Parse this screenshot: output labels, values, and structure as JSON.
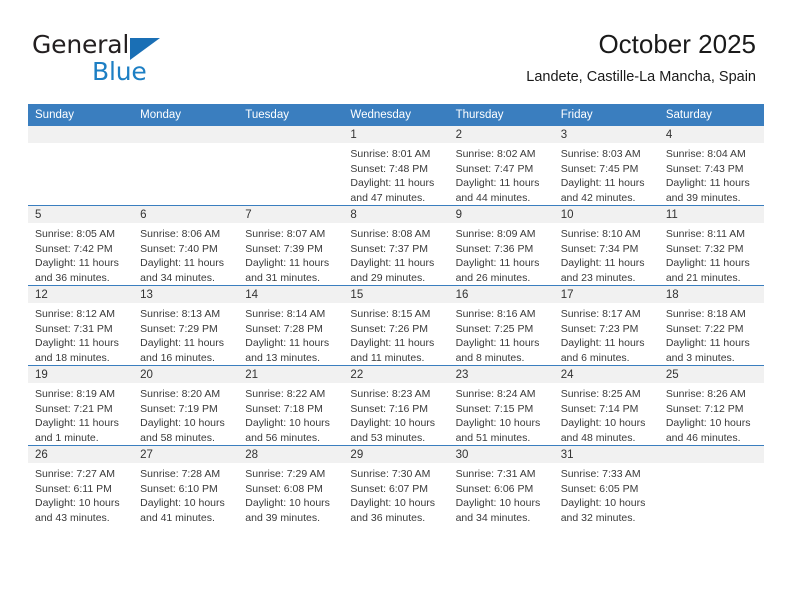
{
  "brand": {
    "name_part1": "General",
    "name_part2": "Blue",
    "triangle_color": "#1a6fb5",
    "blue_color": "#1d7fc4"
  },
  "header": {
    "title": "October 2025",
    "subtitle": "Landete, Castille-La Mancha, Spain"
  },
  "theme": {
    "header_bg": "#3a7ebf",
    "daynum_bg": "#f1f1f1",
    "text": "#3a3a3a"
  },
  "calendar": {
    "weekday_headers": [
      "Sunday",
      "Monday",
      "Tuesday",
      "Wednesday",
      "Thursday",
      "Friday",
      "Saturday"
    ],
    "weeks": [
      [
        {
          "day": "",
          "lines": []
        },
        {
          "day": "",
          "lines": []
        },
        {
          "day": "",
          "lines": []
        },
        {
          "day": "1",
          "lines": [
            "Sunrise: 8:01 AM",
            "Sunset: 7:48 PM",
            "Daylight: 11 hours",
            "and 47 minutes."
          ]
        },
        {
          "day": "2",
          "lines": [
            "Sunrise: 8:02 AM",
            "Sunset: 7:47 PM",
            "Daylight: 11 hours",
            "and 44 minutes."
          ]
        },
        {
          "day": "3",
          "lines": [
            "Sunrise: 8:03 AM",
            "Sunset: 7:45 PM",
            "Daylight: 11 hours",
            "and 42 minutes."
          ]
        },
        {
          "day": "4",
          "lines": [
            "Sunrise: 8:04 AM",
            "Sunset: 7:43 PM",
            "Daylight: 11 hours",
            "and 39 minutes."
          ]
        }
      ],
      [
        {
          "day": "5",
          "lines": [
            "Sunrise: 8:05 AM",
            "Sunset: 7:42 PM",
            "Daylight: 11 hours",
            "and 36 minutes."
          ]
        },
        {
          "day": "6",
          "lines": [
            "Sunrise: 8:06 AM",
            "Sunset: 7:40 PM",
            "Daylight: 11 hours",
            "and 34 minutes."
          ]
        },
        {
          "day": "7",
          "lines": [
            "Sunrise: 8:07 AM",
            "Sunset: 7:39 PM",
            "Daylight: 11 hours",
            "and 31 minutes."
          ]
        },
        {
          "day": "8",
          "lines": [
            "Sunrise: 8:08 AM",
            "Sunset: 7:37 PM",
            "Daylight: 11 hours",
            "and 29 minutes."
          ]
        },
        {
          "day": "9",
          "lines": [
            "Sunrise: 8:09 AM",
            "Sunset: 7:36 PM",
            "Daylight: 11 hours",
            "and 26 minutes."
          ]
        },
        {
          "day": "10",
          "lines": [
            "Sunrise: 8:10 AM",
            "Sunset: 7:34 PM",
            "Daylight: 11 hours",
            "and 23 minutes."
          ]
        },
        {
          "day": "11",
          "lines": [
            "Sunrise: 8:11 AM",
            "Sunset: 7:32 PM",
            "Daylight: 11 hours",
            "and 21 minutes."
          ]
        }
      ],
      [
        {
          "day": "12",
          "lines": [
            "Sunrise: 8:12 AM",
            "Sunset: 7:31 PM",
            "Daylight: 11 hours",
            "and 18 minutes."
          ]
        },
        {
          "day": "13",
          "lines": [
            "Sunrise: 8:13 AM",
            "Sunset: 7:29 PM",
            "Daylight: 11 hours",
            "and 16 minutes."
          ]
        },
        {
          "day": "14",
          "lines": [
            "Sunrise: 8:14 AM",
            "Sunset: 7:28 PM",
            "Daylight: 11 hours",
            "and 13 minutes."
          ]
        },
        {
          "day": "15",
          "lines": [
            "Sunrise: 8:15 AM",
            "Sunset: 7:26 PM",
            "Daylight: 11 hours",
            "and 11 minutes."
          ]
        },
        {
          "day": "16",
          "lines": [
            "Sunrise: 8:16 AM",
            "Sunset: 7:25 PM",
            "Daylight: 11 hours",
            "and 8 minutes."
          ]
        },
        {
          "day": "17",
          "lines": [
            "Sunrise: 8:17 AM",
            "Sunset: 7:23 PM",
            "Daylight: 11 hours",
            "and 6 minutes."
          ]
        },
        {
          "day": "18",
          "lines": [
            "Sunrise: 8:18 AM",
            "Sunset: 7:22 PM",
            "Daylight: 11 hours",
            "and 3 minutes."
          ]
        }
      ],
      [
        {
          "day": "19",
          "lines": [
            "Sunrise: 8:19 AM",
            "Sunset: 7:21 PM",
            "Daylight: 11 hours",
            "and 1 minute."
          ]
        },
        {
          "day": "20",
          "lines": [
            "Sunrise: 8:20 AM",
            "Sunset: 7:19 PM",
            "Daylight: 10 hours",
            "and 58 minutes."
          ]
        },
        {
          "day": "21",
          "lines": [
            "Sunrise: 8:22 AM",
            "Sunset: 7:18 PM",
            "Daylight: 10 hours",
            "and 56 minutes."
          ]
        },
        {
          "day": "22",
          "lines": [
            "Sunrise: 8:23 AM",
            "Sunset: 7:16 PM",
            "Daylight: 10 hours",
            "and 53 minutes."
          ]
        },
        {
          "day": "23",
          "lines": [
            "Sunrise: 8:24 AM",
            "Sunset: 7:15 PM",
            "Daylight: 10 hours",
            "and 51 minutes."
          ]
        },
        {
          "day": "24",
          "lines": [
            "Sunrise: 8:25 AM",
            "Sunset: 7:14 PM",
            "Daylight: 10 hours",
            "and 48 minutes."
          ]
        },
        {
          "day": "25",
          "lines": [
            "Sunrise: 8:26 AM",
            "Sunset: 7:12 PM",
            "Daylight: 10 hours",
            "and 46 minutes."
          ]
        }
      ],
      [
        {
          "day": "26",
          "lines": [
            "Sunrise: 7:27 AM",
            "Sunset: 6:11 PM",
            "Daylight: 10 hours",
            "and 43 minutes."
          ]
        },
        {
          "day": "27",
          "lines": [
            "Sunrise: 7:28 AM",
            "Sunset: 6:10 PM",
            "Daylight: 10 hours",
            "and 41 minutes."
          ]
        },
        {
          "day": "28",
          "lines": [
            "Sunrise: 7:29 AM",
            "Sunset: 6:08 PM",
            "Daylight: 10 hours",
            "and 39 minutes."
          ]
        },
        {
          "day": "29",
          "lines": [
            "Sunrise: 7:30 AM",
            "Sunset: 6:07 PM",
            "Daylight: 10 hours",
            "and 36 minutes."
          ]
        },
        {
          "day": "30",
          "lines": [
            "Sunrise: 7:31 AM",
            "Sunset: 6:06 PM",
            "Daylight: 10 hours",
            "and 34 minutes."
          ]
        },
        {
          "day": "31",
          "lines": [
            "Sunrise: 7:33 AM",
            "Sunset: 6:05 PM",
            "Daylight: 10 hours",
            "and 32 minutes."
          ]
        },
        {
          "day": "",
          "lines": []
        }
      ]
    ]
  }
}
